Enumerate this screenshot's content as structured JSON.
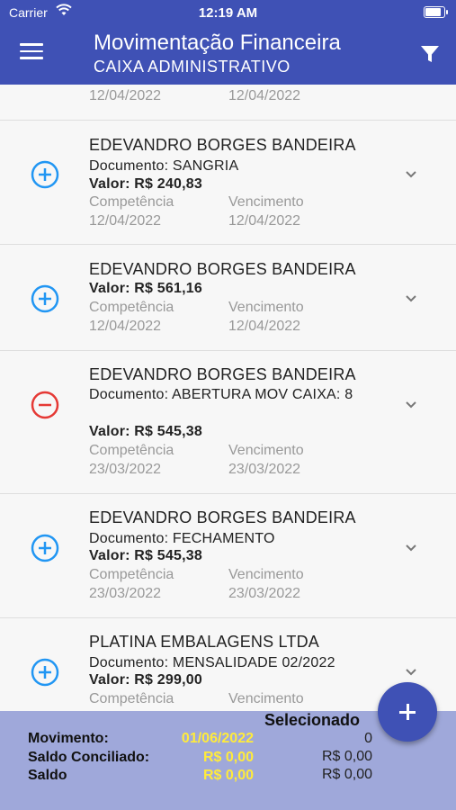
{
  "status_bar": {
    "carrier": "Carrier",
    "time": "12:19 AM"
  },
  "header": {
    "title": "Movimentação Financeira",
    "subtitle": "CAIXA ADMINISTRATIVO"
  },
  "labels": {
    "competencia": "Competência",
    "vencimento": "Vencimento"
  },
  "partial_card": {
    "competencia_date": "12/04/2022",
    "vencimento_date": "12/04/2022"
  },
  "cards": [
    {
      "name": "EDEVANDRO BORGES BANDEIRA",
      "documento": "Documento: SANGRIA",
      "valor": "Valor: R$ 240,83",
      "competencia_date": "12/04/2022",
      "vencimento_date": "12/04/2022",
      "type": "plus",
      "color": "#2196f3"
    },
    {
      "name": "EDEVANDRO BORGES BANDEIRA",
      "valor": "Valor: R$ 561,16",
      "competencia_date": "12/04/2022",
      "vencimento_date": "12/04/2022",
      "type": "plus",
      "color": "#2196f3"
    },
    {
      "name": "EDEVANDRO BORGES BANDEIRA",
      "documento": "Documento: ABERTURA MOV CAIXA: 8",
      "valor": "Valor: R$ 545,38",
      "competencia_date": "23/03/2022",
      "vencimento_date": "23/03/2022",
      "type": "minus",
      "color": "#e53935"
    },
    {
      "name": "EDEVANDRO BORGES BANDEIRA",
      "documento": "Documento: FECHAMENTO",
      "valor": "Valor: R$ 545,38",
      "competencia_date": "23/03/2022",
      "vencimento_date": "23/03/2022",
      "type": "plus",
      "color": "#2196f3"
    },
    {
      "name": "PLATINA EMBALAGENS LTDA",
      "documento": "Documento: MENSALIDADE 02/2022",
      "valor": "Valor: R$ 299,00",
      "type": "plus",
      "color": "#2196f3"
    }
  ],
  "footer": {
    "selecionado_label": "Selecionado",
    "movimento_label": "Movimento:",
    "movimento_date": "01/06/2022",
    "movimento_selected": "0",
    "saldo_conciliado_label": "Saldo Conciliado:",
    "saldo_conciliado_value": "R$ 0,00",
    "saldo_conciliado_selected": "R$ 0,00",
    "saldo_label": "Saldo",
    "saldo_value": "R$ 0,00",
    "saldo_selected": "R$ 0,00"
  },
  "colors": {
    "primary": "#3f51b5",
    "footer_bg": "#9fa8da",
    "highlight": "#ffeb3b",
    "plus": "#2196f3",
    "minus": "#e53935"
  }
}
